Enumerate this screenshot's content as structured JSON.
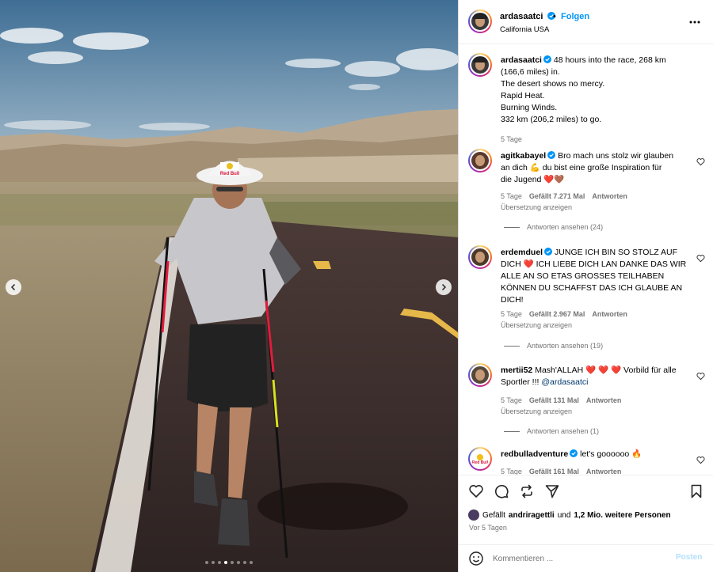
{
  "colors": {
    "accent": "#0095f6",
    "verified": "#0095f6",
    "heart": "#ed4956",
    "muted": "#737373"
  },
  "post": {
    "username": "ardasaatci",
    "separator": "•",
    "follow_label": "Folgen",
    "location": "California USA",
    "caption": {
      "username": "ardasaatci",
      "lines": [
        "48 hours into the race, 268 km",
        "(166,6 miles) in.",
        "The desert shows no mercy.",
        "Rapid Heat.",
        "Burning Winds.",
        "332 km (206,2 miles) to go."
      ],
      "time": "5 Tage"
    }
  },
  "comments": [
    {
      "username": "agitkabayel",
      "lines": [
        "Bro mach uns stolz wir glauben",
        "an dich 💪 du bist eine große Inspiration für",
        "die Jugend ❤️🤎"
      ],
      "time": "5 Tage",
      "likes": "Gefällt 7.271 Mal",
      "reply": "Antworten",
      "translate": "Übersetzung anzeigen",
      "view_replies": "Antworten ansehen (24)"
    },
    {
      "username": "erdemduel",
      "lines": [
        "JUNGE ICH BIN SO STOLZ AUF",
        "DICH ❤️ ICH LIEBE DICH LAN DANKE DAS WIR",
        "ALLE AN SO ETAS GROSSES TEILHABEN",
        "KÖNNEN DU SCHAFFST DAS ICH GLAUBE AN",
        "DICH!"
      ],
      "time": "5 Tage",
      "likes": "Gefällt 2.967 Mal",
      "reply": "Antworten",
      "translate": "Übersetzung anzeigen",
      "view_replies": "Antworten ansehen (19)"
    },
    {
      "username": "mertii52",
      "lines": [
        "Mash'ALLAH ❤️ ❤️ ❤️ Vorbild für alle",
        "Sportler !!! "
      ],
      "mention": "@ardasaatci",
      "time": "5 Tage",
      "likes": "Gefällt 131 Mal",
      "reply": "Antworten",
      "translate": "Übersetzung anzeigen",
      "view_replies": "Antworten ansehen (1)"
    },
    {
      "username": "redbulladventure",
      "lines": [
        "let's goooooo 🔥"
      ],
      "time": "5 Tage",
      "likes": "Gefällt 161 Mal",
      "reply": "Antworten"
    }
  ],
  "likes_summary": {
    "prefix": "Gefällt",
    "user": "andriragettli",
    "joiner": "und",
    "rest": "1,2 Mio. weitere Personen"
  },
  "post_date": "Vor 5 Tagen",
  "composer": {
    "placeholder": "Kommentieren ...",
    "post_label": "Posten"
  },
  "media": {
    "icons": [
      "chevron-left-icon",
      "chevron-right-icon"
    ],
    "carousel": {
      "count": 8,
      "active": 4
    },
    "cap_logo_text": "Red Bull"
  }
}
